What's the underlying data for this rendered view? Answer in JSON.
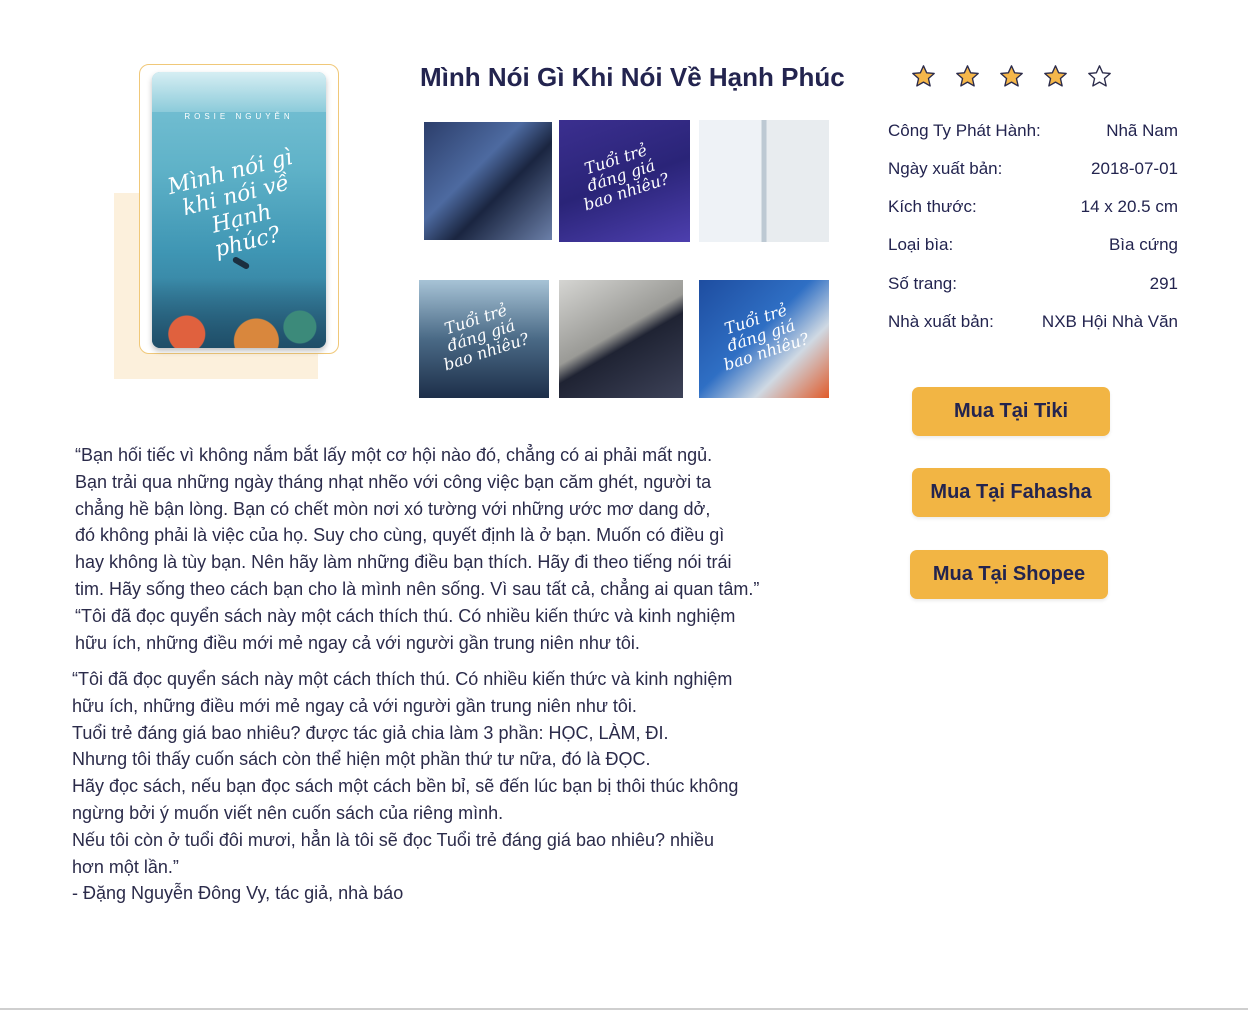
{
  "book": {
    "title": "Mình Nói Gì Khi Nói Về Hạnh Phúc",
    "cover_author": "ROSIE NGUYỄN",
    "cover_title": "Mình nói gì khi nói về Hạnh phúc?",
    "rating": 4,
    "rating_max": 5
  },
  "gallery": {
    "thumb_titles": [
      "",
      "Tuổi trẻ đáng giá bao nhiêu?",
      "",
      "Tuổi trẻ đáng giá bao nhiêu?",
      "",
      "Tuổi trẻ đáng giá bao nhiêu?"
    ]
  },
  "details": [
    {
      "label": "Công Ty Phát Hành:",
      "value": "Nhã Nam"
    },
    {
      "label": "Ngày xuất bản:",
      "value": "2018-07-01"
    },
    {
      "label": "Kích thước:",
      "value": "14 x 20.5 cm"
    },
    {
      "label": "Loại bìa:",
      "value": "Bìa cứng"
    },
    {
      "label": "Số trang:",
      "value": "291"
    },
    {
      "label": "Nhà xuất bản:",
      "value": "NXB Hội Nhà Văn"
    }
  ],
  "buttons": {
    "tiki": "Mua Tại Tiki",
    "fahasha": "Mua Tại Fahasha",
    "shopee": "Mua Tại Shopee"
  },
  "description_1": [
    "“Bạn hối tiếc vì không nắm bắt lấy một cơ hội nào đó, chẳng có ai phải mất ngủ.",
    "Bạn trải qua những ngày tháng nhạt nhẽo với công việc bạn căm ghét, người ta",
    "chẳng hề bận lòng. Bạn có chết mòn nơi xó tường với những ước mơ dang dở,",
    "đó không phải là việc của họ. Suy cho cùng, quyết định là ở bạn. Muốn có điều gì",
    "hay không là tùy bạn. Nên hãy làm những điều bạn thích. Hãy đi theo tiếng nói trái",
    "tim. Hãy sống theo cách bạn cho là mình nên sống. Vì sau tất cả, chẳng ai quan tâm.”",
    "“Tôi đã đọc quyển sách này một cách thích thú. Có nhiều kiến thức và kinh nghiệm",
    "hữu ích, những điều mới mẻ ngay cả với người gần trung niên như tôi."
  ],
  "description_2": [
    "“Tôi đã đọc quyển sách này một cách thích thú. Có nhiều kiến thức và kinh nghiệm",
    "hữu ích, những điều mới mẻ ngay cả với người gần trung niên như tôi.",
    "Tuổi trẻ đáng giá bao nhiêu? được tác giả chia làm 3 phần: HỌC, LÀM, ĐI.",
    "Nhưng tôi thấy cuốn sách còn thể hiện một phần thứ tư nữa, đó là ĐỌC.",
    "Hãy đọc sách, nếu bạn đọc sách một cách bền bỉ, sẽ đến lúc bạn bị thôi thúc không",
    "ngừng bởi ý muốn viết nên cuốn sách của riêng mình.",
    "Nếu tôi còn ở tuổi đôi mươi, hẳn là tôi sẽ đọc Tuổi trẻ đáng giá bao nhiêu? nhiều",
    "hơn một lần.”",
    "- Đặng Nguyễn Đông Vy, tác giả, nhà báo"
  ],
  "colors": {
    "accent": "#f2b544",
    "text": "#23244f",
    "star_fill": "#f5b74a",
    "star_stroke": "#2b2b4a"
  },
  "icons": {
    "star_filled": "star-filled-icon",
    "star_empty": "star-outline-icon"
  }
}
